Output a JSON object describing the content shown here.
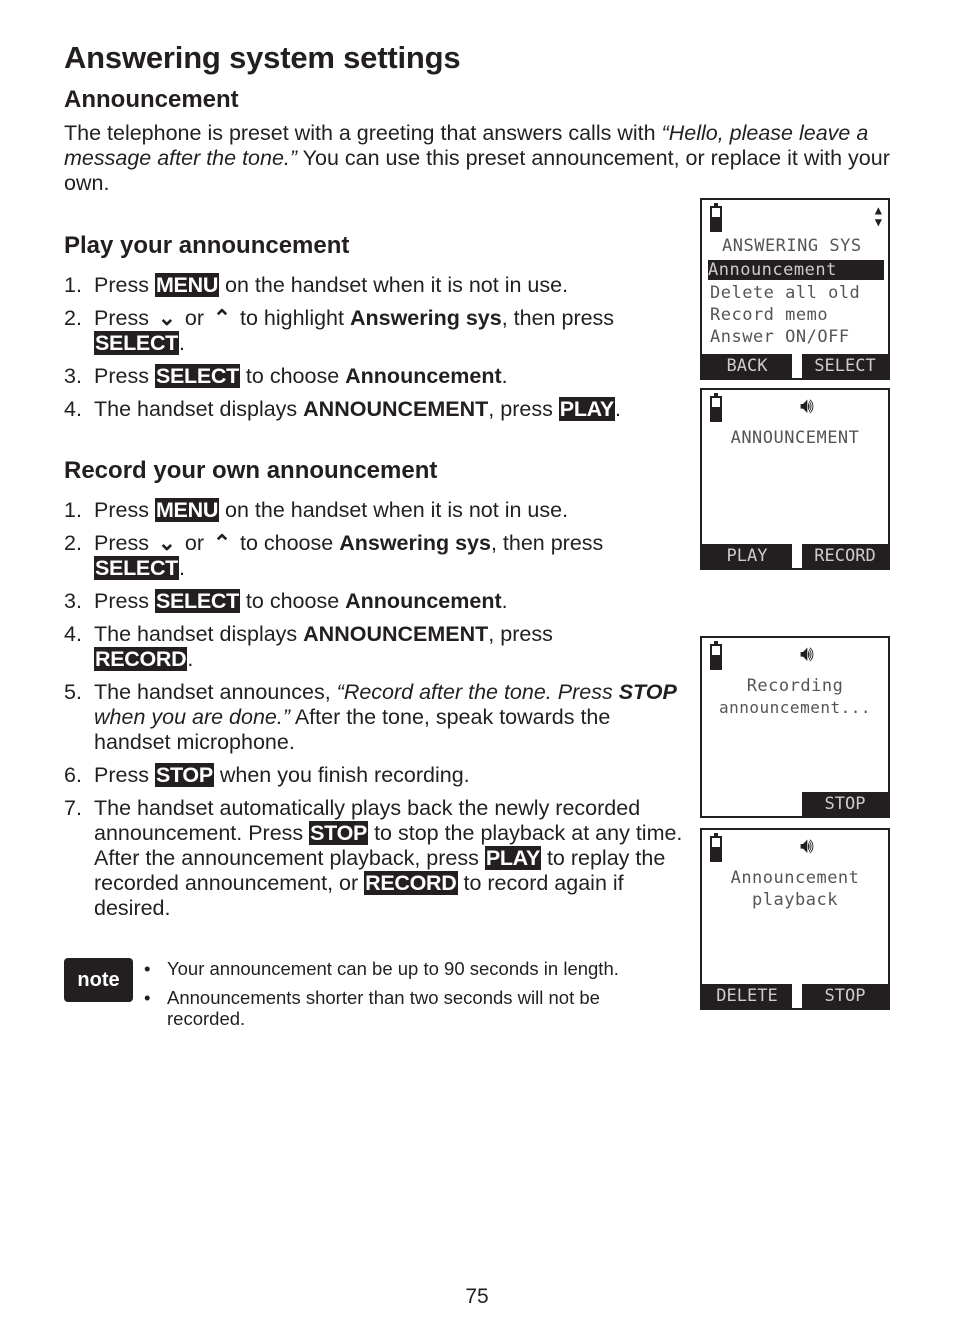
{
  "page": {
    "title": "Answering system settings",
    "section_title": "Announcement",
    "intro_pre": "The telephone is preset with a greeting that answers calls with ",
    "intro_quote": "“Hello, please leave a message after the tone.”",
    "intro_post": "  You can use this preset announcement, or replace it with your own.",
    "page_number": "75"
  },
  "play": {
    "heading": "Play your announcement",
    "steps": [
      {
        "num": "1.",
        "a": "Press ",
        "key": "MENU",
        "b": " on the handset when it is not in use."
      },
      {
        "num": "2.",
        "a": "Press ",
        "down": "⌄",
        "or": " or ",
        "up": "⌃",
        "b": " to highlight ",
        "bold": "Answering sys",
        "c": ", then press ",
        "key": "SELECT",
        "d": "."
      },
      {
        "num": "3.",
        "a": "Press ",
        "key": "SELECT",
        "b": " to choose ",
        "bold": "Announcement",
        "c": "."
      },
      {
        "num": "4.",
        "a": "The handset displays ",
        "bold": "ANNOUNCEMENT",
        "b": ", press ",
        "key": "PLAY",
        "c": "."
      }
    ]
  },
  "record": {
    "heading": "Record your own announcement",
    "steps": [
      {
        "num": "1.",
        "a": "Press ",
        "key": "MENU",
        "b": " on the handset when it is not in use."
      },
      {
        "num": "2.",
        "a": "Press ",
        "down": "⌄",
        "or": " or ",
        "up": "⌃",
        "b": " to choose ",
        "bold": "Answering sys",
        "c": ", then press ",
        "key": "SELECT",
        "d": "."
      },
      {
        "num": "3.",
        "a": "Press ",
        "key": "SELECT",
        "b": " to choose ",
        "bold": "Announcement",
        "c": "."
      },
      {
        "num": "4.",
        "a": "The handset displays ",
        "bold": "ANNOUNCEMENT",
        "b": ", press ",
        "key": "RECORD",
        "c": "."
      },
      {
        "num": "5.",
        "a": "The handset announces, ",
        "i1": "“Record after the tone. Press ",
        "ib": "STOP",
        "i2": " when you are done.”",
        "b": "  After the tone, speak towards the handset microphone."
      },
      {
        "num": "6.",
        "a": "Press ",
        "key": "STOP",
        "b": " when you finish recording."
      },
      {
        "num": "7.",
        "a": "The handset automatically plays back the newly recorded announcement. Press ",
        "key": "STOP",
        "b": " to stop the playback at any time. After the announcement playback, press ",
        "key2": "PLAY",
        "c": " to replay the recorded announcement, or ",
        "key3": "RECORD",
        "d": " to record again if desired."
      }
    ]
  },
  "note": {
    "label": "note",
    "items": [
      "Your announcement can be up to 90 seconds in length.",
      "Announcements shorter than two seconds will not be recorded."
    ]
  },
  "screens": {
    "menu": {
      "title": "ANSWERING SYS",
      "items": [
        "Announcement",
        "Delete all old",
        "Record memo",
        "Answer ON/OFF"
      ],
      "selected": "Announcement",
      "left_soft": "BACK",
      "right_soft": "SELECT"
    },
    "announcement": {
      "text": "ANNOUNCEMENT",
      "left_soft": "PLAY",
      "right_soft": "RECORD"
    },
    "recording": {
      "line1": "Recording",
      "line2": "announcement...",
      "right_soft": "STOP"
    },
    "playback": {
      "line1": "Announcement",
      "line2": "playback",
      "left_soft": "DELETE",
      "right_soft": "STOP"
    }
  }
}
